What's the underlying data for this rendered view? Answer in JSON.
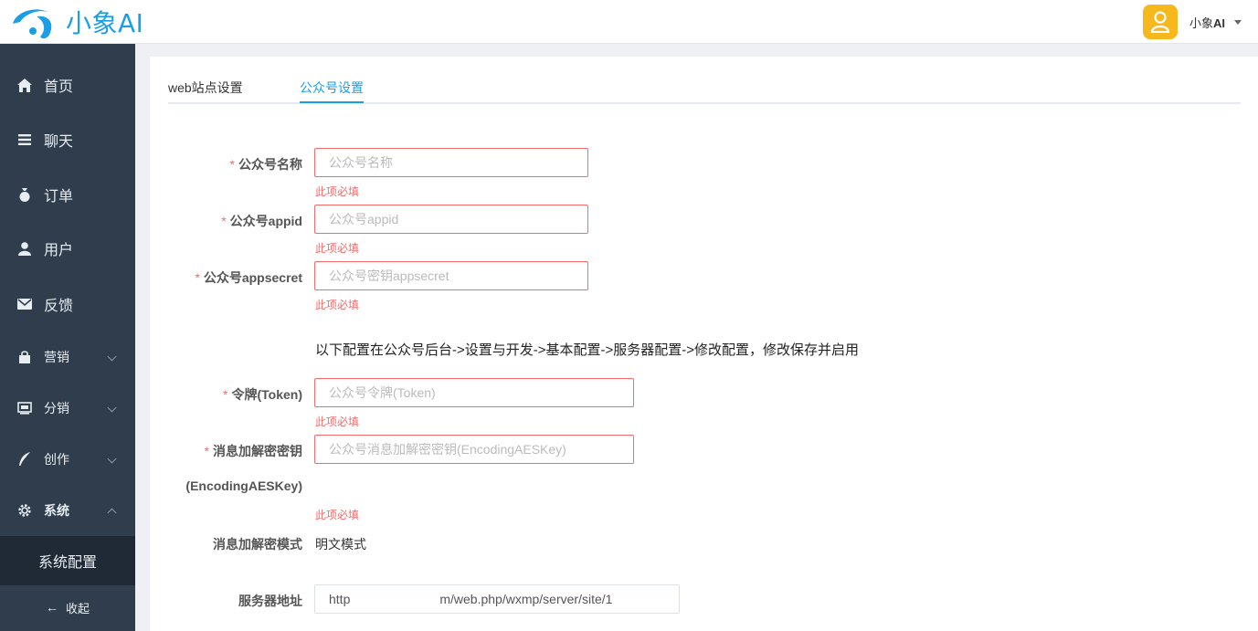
{
  "header": {
    "logo_text": "小象AI",
    "user_name_prefix": "小象",
    "user_name_suffix": "AI"
  },
  "sidebar": {
    "items": [
      {
        "label": "首页",
        "icon": "home-icon"
      },
      {
        "label": "聊天",
        "icon": "menu-lines-icon"
      },
      {
        "label": "订单",
        "icon": "money-bag-icon"
      },
      {
        "label": "用户",
        "icon": "user-icon"
      },
      {
        "label": "反馈",
        "icon": "mail-icon"
      },
      {
        "label": "营销",
        "icon": "bag-icon"
      },
      {
        "label": "分销",
        "icon": "share-icon"
      },
      {
        "label": "创作",
        "icon": "feather-icon"
      },
      {
        "label": "系统",
        "icon": "gear-icon"
      }
    ],
    "sub_item": "系统配置",
    "collapse_label": "收起"
  },
  "tabs": [
    {
      "label": "web站点设置",
      "active": false
    },
    {
      "label": "公众号设置",
      "active": true
    }
  ],
  "form": {
    "name_label": "公众号名称",
    "name_placeholder": "公众号名称",
    "appid_label": "公众号appid",
    "appid_placeholder": "公众号appid",
    "secret_label": "公众号appsecret",
    "secret_placeholder": "公众号密钥appsecret",
    "required_msg": "此项必填",
    "hint": "以下配置在公众号后台->设置与开发->基本配置->服务器配置->修改配置，修改保存并启用",
    "token_label": "令牌(Token)",
    "token_placeholder": "公众号令牌(Token)",
    "aes_label_line1": "消息加解密密钥",
    "aes_label_line2": "(EncodingAESKey)",
    "aes_placeholder": "公众号消息加解密密钥(EncodingAESKey)",
    "mode_label": "消息加解密模式",
    "mode_value": "明文模式",
    "server_label": "服务器地址",
    "server_value_start": "http",
    "server_value_end": "m/web.php/wxmp/server/site/1"
  },
  "colors": {
    "brand": "#1a9ee6",
    "sidebar_bg": "#2f3d4c",
    "error": "#f56c6c",
    "avatar": "#f6b81d"
  }
}
